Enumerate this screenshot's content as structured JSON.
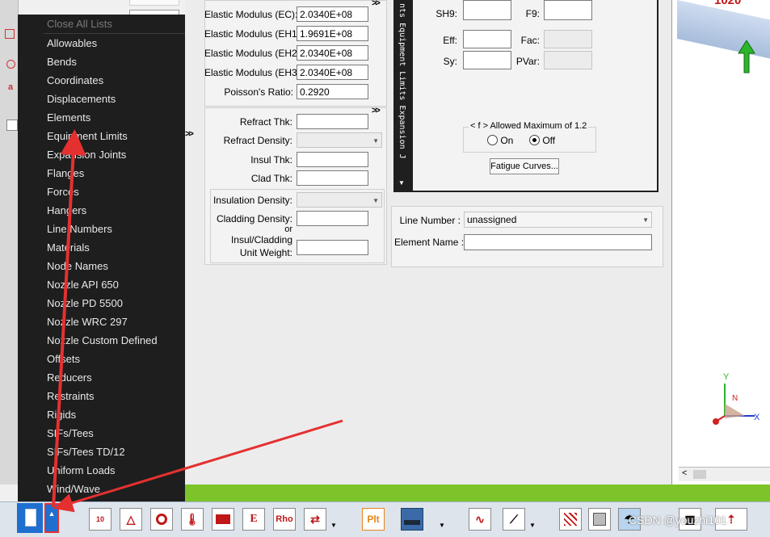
{
  "menu": {
    "header": "Close All Lists",
    "items": [
      "Allowables",
      "Bends",
      "Coordinates",
      "Displacements",
      "Elements",
      "Equipment Limits",
      "Expansion Joints",
      "Flanges",
      "Forces",
      "Hangers",
      "Line Numbers",
      "Materials",
      "Node Names",
      "Nozzle API 650",
      "Nozzle PD 5500",
      "Nozzle WRC 297",
      "Nozzle Custom Defined",
      "Offsets",
      "Reducers",
      "Restraints",
      "Rigids",
      "SIFs/Tees",
      "SIFs/Tees TD/12",
      "Uniform Loads",
      "Wind/Wave"
    ]
  },
  "material": {
    "fields": [
      {
        "label": "Elastic Modulus (EC):",
        "value": "2.0340E+08"
      },
      {
        "label": "Elastic Modulus (EH1):",
        "value": "1.9691E+08"
      },
      {
        "label": "Elastic Modulus (EH2):",
        "value": "2.0340E+08"
      },
      {
        "label": "Elastic Modulus (EH3):",
        "value": "2.0340E+08"
      },
      {
        "label": "Poisson's Ratio:",
        "value": "0.2920"
      }
    ],
    "more": ">>"
  },
  "refract": {
    "more": ">>",
    "thk_label": "Refract Thk:",
    "density_label": "Refract Density:",
    "insul_thk_label": "Insul Thk:",
    "clad_thk_label": "Clad Thk:",
    "insul_density_label": "Insulation Density:",
    "cladding_density_label": "Cladding Density:",
    "or_label": "or",
    "unit_weight_label1": "Insul/Cladding",
    "unit_weight_label2": "Unit Weight:"
  },
  "allowables": {
    "sh9_label": "SH9:",
    "f9_label": "F9:",
    "eff_label": "Eff:",
    "fac_label": "Fac:",
    "sy_label": "Sy:",
    "pvar_label": "PVar:",
    "group_label": "< f > Allowed Maximum of 1.2",
    "on_label": "On",
    "off_label": "Off",
    "fatigue_button": "Fatigue Curves...",
    "vertical_tabs": "nts  Equipment Limits  Expansion J"
  },
  "line": {
    "line_number_label": "Line Number :",
    "line_number_value": "unassigned",
    "element_name_label": "Element Name :"
  },
  "view": {
    "node_label": "1020",
    "axis_y": "Y",
    "axis_x": "X",
    "axis_z": "N"
  },
  "toolbar": {
    "icons": [
      "10",
      "E",
      "Rho",
      "Plt"
    ]
  },
  "watermark": "CSDN @youzhi101",
  "colors": {
    "menu_bg": "#1e1e1e",
    "accent_green": "#7cc42a",
    "arrow_red": "#e53030",
    "selected_blue": "#1e6fd0"
  }
}
